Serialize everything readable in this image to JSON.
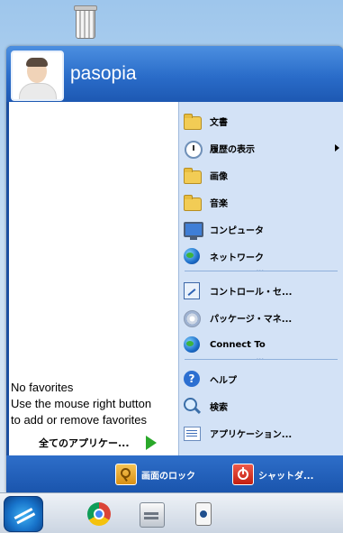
{
  "user": {
    "name": "pasopia"
  },
  "favorites": {
    "empty_message": [
      "No favorites",
      "Use the mouse right button",
      "to add or remove favorites"
    ],
    "all_apps_label": "全てのアプリケー..."
  },
  "places": [
    {
      "label": "文書",
      "icon": "documents-folder-icon"
    },
    {
      "label": "履歴の表示",
      "icon": "history-clock-icon",
      "submenu": true
    },
    {
      "label": "画像",
      "icon": "pictures-folder-icon"
    },
    {
      "label": "音楽",
      "icon": "music-folder-icon"
    },
    {
      "label": "コンピュータ",
      "icon": "computer-icon"
    },
    {
      "label": "ネットワーク",
      "icon": "network-icon"
    }
  ],
  "system": [
    {
      "label": "コントロール・セ...",
      "icon": "control-panel-icon"
    },
    {
      "label": "パッケージ・マネ...",
      "icon": "package-manager-icon"
    },
    {
      "label": "Connect To",
      "icon": "connect-globe-icon"
    }
  ],
  "tools": [
    {
      "label": "ヘルプ",
      "icon": "help-icon"
    },
    {
      "label": "検索",
      "icon": "search-icon"
    },
    {
      "label": "アプリケーション...",
      "icon": "applications-icon"
    }
  ],
  "bottom_bar": {
    "lock_label": "画面のロック",
    "shutdown_label": "シャットダ..."
  },
  "taskbar": {
    "icons": [
      "start-menu-icon",
      "chrome-icon",
      "file-manager-icon",
      "device-icon"
    ]
  },
  "desktop": {
    "icons": [
      "trash-icon"
    ]
  }
}
